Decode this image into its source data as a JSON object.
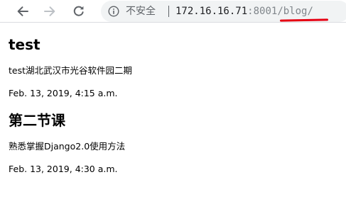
{
  "browser": {
    "security_label": "不安全",
    "url_host": "172.16.16.71",
    "url_port": ":8001",
    "url_path": "/blog/",
    "accent_underline": "#e60012"
  },
  "icons": {
    "back": "arrow-left-icon",
    "forward": "arrow-right-icon",
    "reload": "reload-icon",
    "info": "info-icon"
  },
  "posts": [
    {
      "title": "test",
      "body": "test湖北武汉市光谷软件园二期",
      "date": "Feb. 13, 2019, 4:15 a.m."
    },
    {
      "title": "第二节课",
      "body": "熟悉掌握Django2.0使用方法",
      "date": "Feb. 13, 2019, 4:30 a.m."
    }
  ]
}
